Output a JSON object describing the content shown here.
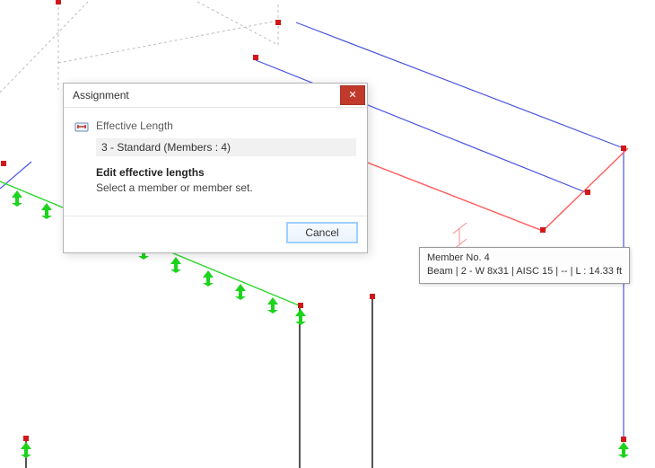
{
  "dialog": {
    "title": "Assignment",
    "section_title": "Effective Length",
    "list_item": "3 - Standard (Members : 4)",
    "instruction_bold": "Edit effective lengths",
    "instruction_sub": "Select a member or member set.",
    "cancel_label": "Cancel"
  },
  "tooltip": {
    "line1": "Member No. 4",
    "line2": "Beam | 2 - W 8x31 | AISC 15 | -- | L : 14.33 ft"
  },
  "colors": {
    "blue_line": "#4a55e0",
    "red_line": "#ff5a5a",
    "green_line": "#2bd82b",
    "dash_line": "#bdbdbd",
    "black_line": "#2a2a2a",
    "node": "#d01818",
    "support": "#1cd41c"
  }
}
